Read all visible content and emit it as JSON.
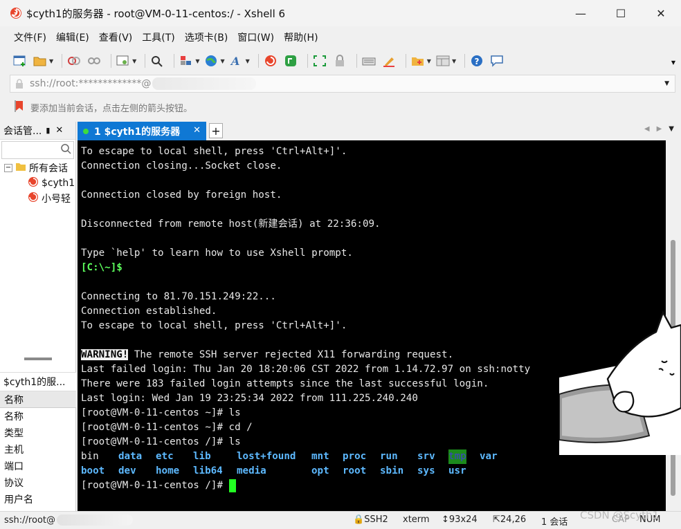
{
  "window": {
    "title": "$cyth1的服务器 - root@VM-0-11-centos:/ - Xshell 6",
    "minimize": "—",
    "maximize": "☐",
    "close": "✕"
  },
  "menu": [
    "文件(F)",
    "编辑(E)",
    "查看(V)",
    "工具(T)",
    "选项卡(B)",
    "窗口(W)",
    "帮助(H)"
  ],
  "address": {
    "text": "ssh://root:*************@"
  },
  "hint": "要添加当前会话，点击左侧的箭头按钮。",
  "session_panel": {
    "title": "会话管...",
    "pin": "📌",
    "close": "✕",
    "tree": {
      "root": "所有会话",
      "items": [
        "$cyth1",
        "小号轻"
      ]
    }
  },
  "properties": {
    "title": "$cyth1的服...",
    "rows": [
      "名称",
      "名称",
      "类型",
      "主机",
      "端口",
      "协议",
      "用户名"
    ]
  },
  "tab": {
    "label": "1 $cyth1的服务器",
    "close": "✕",
    "add": "+"
  },
  "terminal": {
    "lines": [
      "To escape to local shell, press 'Ctrl+Alt+]'.",
      "Connection closing...Socket close.",
      "",
      "Connection closed by foreign host.",
      "",
      "Disconnected from remote host(新建会话) at 22:36:09.",
      "",
      "Type `help' to learn how to use Xshell prompt.",
      "[C:\\~]$",
      "",
      "Connecting to 81.70.151.249:22...",
      "Connection established.",
      "To escape to local shell, press 'Ctrl+Alt+]'.",
      "",
      "WARNING!",
      "Last failed login: Thu Jan 20 18:20:06 CST 2022 from 1.14.72.97 on ssh:notty",
      "There were 183 failed login attempts since the last successful login.",
      "Last login: Wed Jan 19 23:25:34 2022 from 111.225.240.240",
      "[root@VM-0-11-centos ~]# ls",
      "[root@VM-0-11-centos ~]# cd /",
      "[root@VM-0-11-centos /]# ls",
      "",
      "",
      "[root@VM-0-11-centos /]# "
    ],
    "warning_rest": " The remote SSH server rejected X11 forwarding request.",
    "ls_row1": [
      "bin",
      "data",
      "etc",
      "lib",
      "lost+found",
      "mnt",
      "proc",
      "run",
      "srv",
      "tmp",
      "var"
    ],
    "ls_row2": [
      "boot",
      "dev",
      "home",
      "lib64",
      "media",
      "opt",
      "root",
      "sbin",
      "sys",
      "usr"
    ]
  },
  "status": {
    "address": "ssh://root@",
    "protocol": "SSH2",
    "term": "xterm",
    "size": "93x24",
    "cursor": "24,26",
    "sessions": "1 会话",
    "caps": "CAP",
    "num": "NUM"
  },
  "watermark": "CSDN @Scyth1",
  "colors": {
    "tab_active": "#0f78d4",
    "terminal_bg": "#000000",
    "prompt_green": "#5dff5d",
    "dir_blue": "#5db9ff"
  }
}
